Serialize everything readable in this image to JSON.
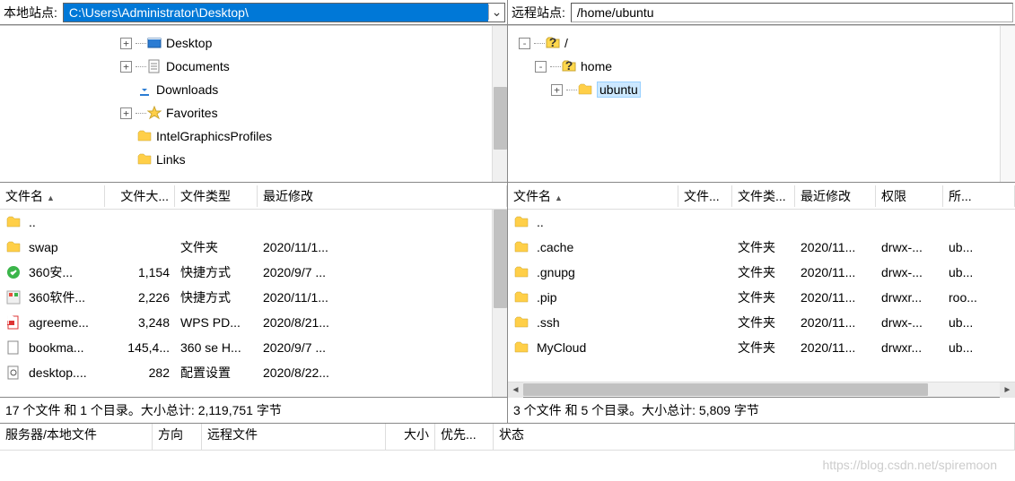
{
  "local": {
    "site_label": "本地站点:",
    "path": "C:\\Users\\Administrator\\Desktop\\",
    "tree": [
      {
        "ind": 130,
        "exp": "+",
        "ico": "folder-blue",
        "label": "Desktop"
      },
      {
        "ind": 130,
        "exp": "+",
        "ico": "doc",
        "label": "Documents"
      },
      {
        "ind": 148,
        "exp": "",
        "ico": "download",
        "label": "Downloads"
      },
      {
        "ind": 130,
        "exp": "+",
        "ico": "fav",
        "label": "Favorites"
      },
      {
        "ind": 148,
        "exp": "",
        "ico": "folder",
        "label": "IntelGraphicsProfiles"
      },
      {
        "ind": 148,
        "exp": "",
        "ico": "folder",
        "label": "Links"
      }
    ],
    "cols": {
      "name": "文件名",
      "size": "文件大...",
      "type": "文件类型",
      "modified": "最近修改"
    },
    "rows": [
      {
        "ico": "folder",
        "name": "..",
        "size": "",
        "type": "",
        "modified": ""
      },
      {
        "ico": "folder",
        "name": "swap",
        "size": "",
        "type": "文件夹",
        "modified": "2020/11/1..."
      },
      {
        "ico": "app-green",
        "name": "360安...",
        "size": "1,154",
        "type": "快捷方式",
        "modified": "2020/9/7 ..."
      },
      {
        "ico": "app-orange",
        "name": "360软件...",
        "size": "2,226",
        "type": "快捷方式",
        "modified": "2020/11/1..."
      },
      {
        "ico": "pdf",
        "name": "agreeme...",
        "size": "3,248",
        "type": "WPS PD...",
        "modified": "2020/8/21..."
      },
      {
        "ico": "file",
        "name": "bookma...",
        "size": "145,4...",
        "type": "360 se H...",
        "modified": "2020/9/7 ..."
      },
      {
        "ico": "ini",
        "name": "desktop....",
        "size": "282",
        "type": "配置设置",
        "modified": "2020/8/22..."
      }
    ],
    "status": "17 个文件 和 1 个目录。大小总计: 2,119,751 字节"
  },
  "remote": {
    "site_label": "远程站点:",
    "path": "/home/ubuntu",
    "tree": [
      {
        "ind": 8,
        "exp": "-",
        "ico": "unknown",
        "label": "/"
      },
      {
        "ind": 26,
        "exp": "-",
        "ico": "unknown",
        "label": "home"
      },
      {
        "ind": 44,
        "exp": "+",
        "ico": "folder",
        "label": "ubuntu",
        "selected": true
      }
    ],
    "cols": {
      "name": "文件名",
      "size": "文件...",
      "type": "文件类...",
      "modified": "最近修改",
      "perm": "权限",
      "own": "所..."
    },
    "rows": [
      {
        "ico": "folder",
        "name": "..",
        "size": "",
        "type": "",
        "modified": "",
        "perm": "",
        "own": ""
      },
      {
        "ico": "folder",
        "name": ".cache",
        "size": "",
        "type": "文件夹",
        "modified": "2020/11...",
        "perm": "drwx-...",
        "own": "ub..."
      },
      {
        "ico": "folder",
        "name": ".gnupg",
        "size": "",
        "type": "文件夹",
        "modified": "2020/11...",
        "perm": "drwx-...",
        "own": "ub..."
      },
      {
        "ico": "folder",
        "name": ".pip",
        "size": "",
        "type": "文件夹",
        "modified": "2020/11...",
        "perm": "drwxr...",
        "own": "roo..."
      },
      {
        "ico": "folder",
        "name": ".ssh",
        "size": "",
        "type": "文件夹",
        "modified": "2020/11...",
        "perm": "drwx-...",
        "own": "ub..."
      },
      {
        "ico": "folder",
        "name": "MyCloud",
        "size": "",
        "type": "文件夹",
        "modified": "2020/11...",
        "perm": "drwxr...",
        "own": "ub..."
      }
    ],
    "status": "3 个文件 和 5 个目录。大小总计: 5,809 字节"
  },
  "queue": {
    "cols": {
      "server": "服务器/本地文件",
      "dir": "方向",
      "remote": "远程文件",
      "size": "大小",
      "prio": "优先...",
      "status": "状态"
    }
  },
  "watermark": "https://blog.csdn.net/spiremoon"
}
